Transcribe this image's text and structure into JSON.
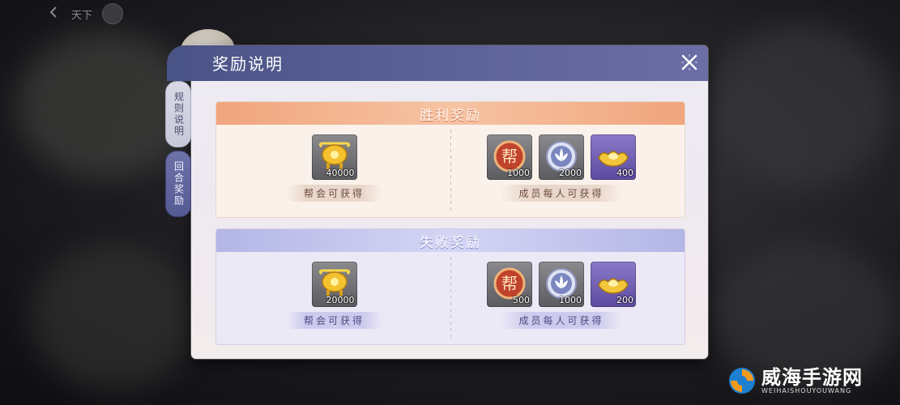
{
  "topbar": {
    "label": "天下"
  },
  "panel": {
    "title": "奖励说明",
    "tabs": [
      {
        "label": "规则说明",
        "active": false
      },
      {
        "label": "回合奖励",
        "active": true
      }
    ]
  },
  "sections": {
    "victory": {
      "title": "胜利奖励",
      "guild": {
        "caption": "帮会可获得",
        "items": [
          {
            "icon": "gold-cauldron-icon",
            "qty": "40000"
          }
        ]
      },
      "member": {
        "caption": "成员每人可获得",
        "items": [
          {
            "icon": "guild-token-icon",
            "qty": "1000"
          },
          {
            "icon": "silver-lotus-coin-icon",
            "qty": "2000"
          },
          {
            "icon": "gold-ingot-icon",
            "qty": "400"
          }
        ]
      }
    },
    "defeat": {
      "title": "失败奖励",
      "guild": {
        "caption": "帮会可获得",
        "items": [
          {
            "icon": "gold-cauldron-icon",
            "qty": "20000"
          }
        ]
      },
      "member": {
        "caption": "成员每人可获得",
        "items": [
          {
            "icon": "guild-token-icon",
            "qty": "500"
          },
          {
            "icon": "silver-lotus-coin-icon",
            "qty": "1000"
          },
          {
            "icon": "gold-ingot-icon",
            "qty": "200"
          }
        ]
      }
    }
  },
  "colors": {
    "header": "#5a6096",
    "victory_bar": "#f0a57d",
    "defeat_bar": "#b3b6e6",
    "active_tab": "#545a92"
  },
  "watermark": {
    "text": "威海手游网",
    "sub": "WEIHAISHOUYOUWANG"
  }
}
